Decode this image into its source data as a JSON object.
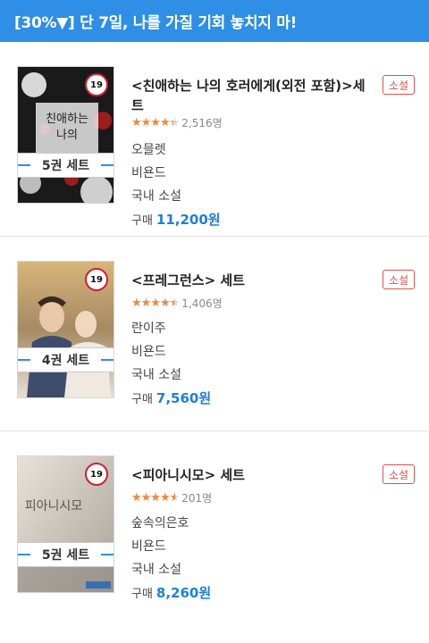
{
  "banner": {
    "text": "[30%▼] 단 7일, 나를 가질 기회 놓치지 마!"
  },
  "items": [
    {
      "title": "<친애하는 나의 호러에게(외전 포함)>세트",
      "tag": "소설",
      "age": "19",
      "set_label": "5권 세트",
      "rating_fraction": 0.88,
      "rating_count": "2,516명",
      "author": "오믈렛",
      "publisher": "비욘드",
      "category": "국내 소설",
      "price_label": "구매",
      "price": "11,200원",
      "cover_colors": [
        "#1a1a1a",
        "#c8c8c8",
        "#8e1b1b"
      ]
    },
    {
      "title": "<프레그런스> 세트",
      "tag": "소설",
      "age": "19",
      "set_label": "4권 세트",
      "rating_fraction": 0.9,
      "rating_count": "1,406명",
      "author": "란이주",
      "publisher": "비욘드",
      "category": "국내 소설",
      "price_label": "구매",
      "price": "7,560원",
      "cover_colors": [
        "#c9a46a",
        "#4a5a7a",
        "#e9e3da"
      ]
    },
    {
      "title": "<피아니시모> 세트",
      "tag": "소설",
      "age": "19",
      "set_label": "5권 세트",
      "rating_fraction": 0.92,
      "rating_count": "201명",
      "author": "숲속의은호",
      "publisher": "비욘드",
      "category": "국내 소설",
      "price_label": "구매",
      "price": "8,260원",
      "cover_colors": [
        "#ddd6cc",
        "#b9b1a6",
        "#8f8a84"
      ]
    }
  ]
}
